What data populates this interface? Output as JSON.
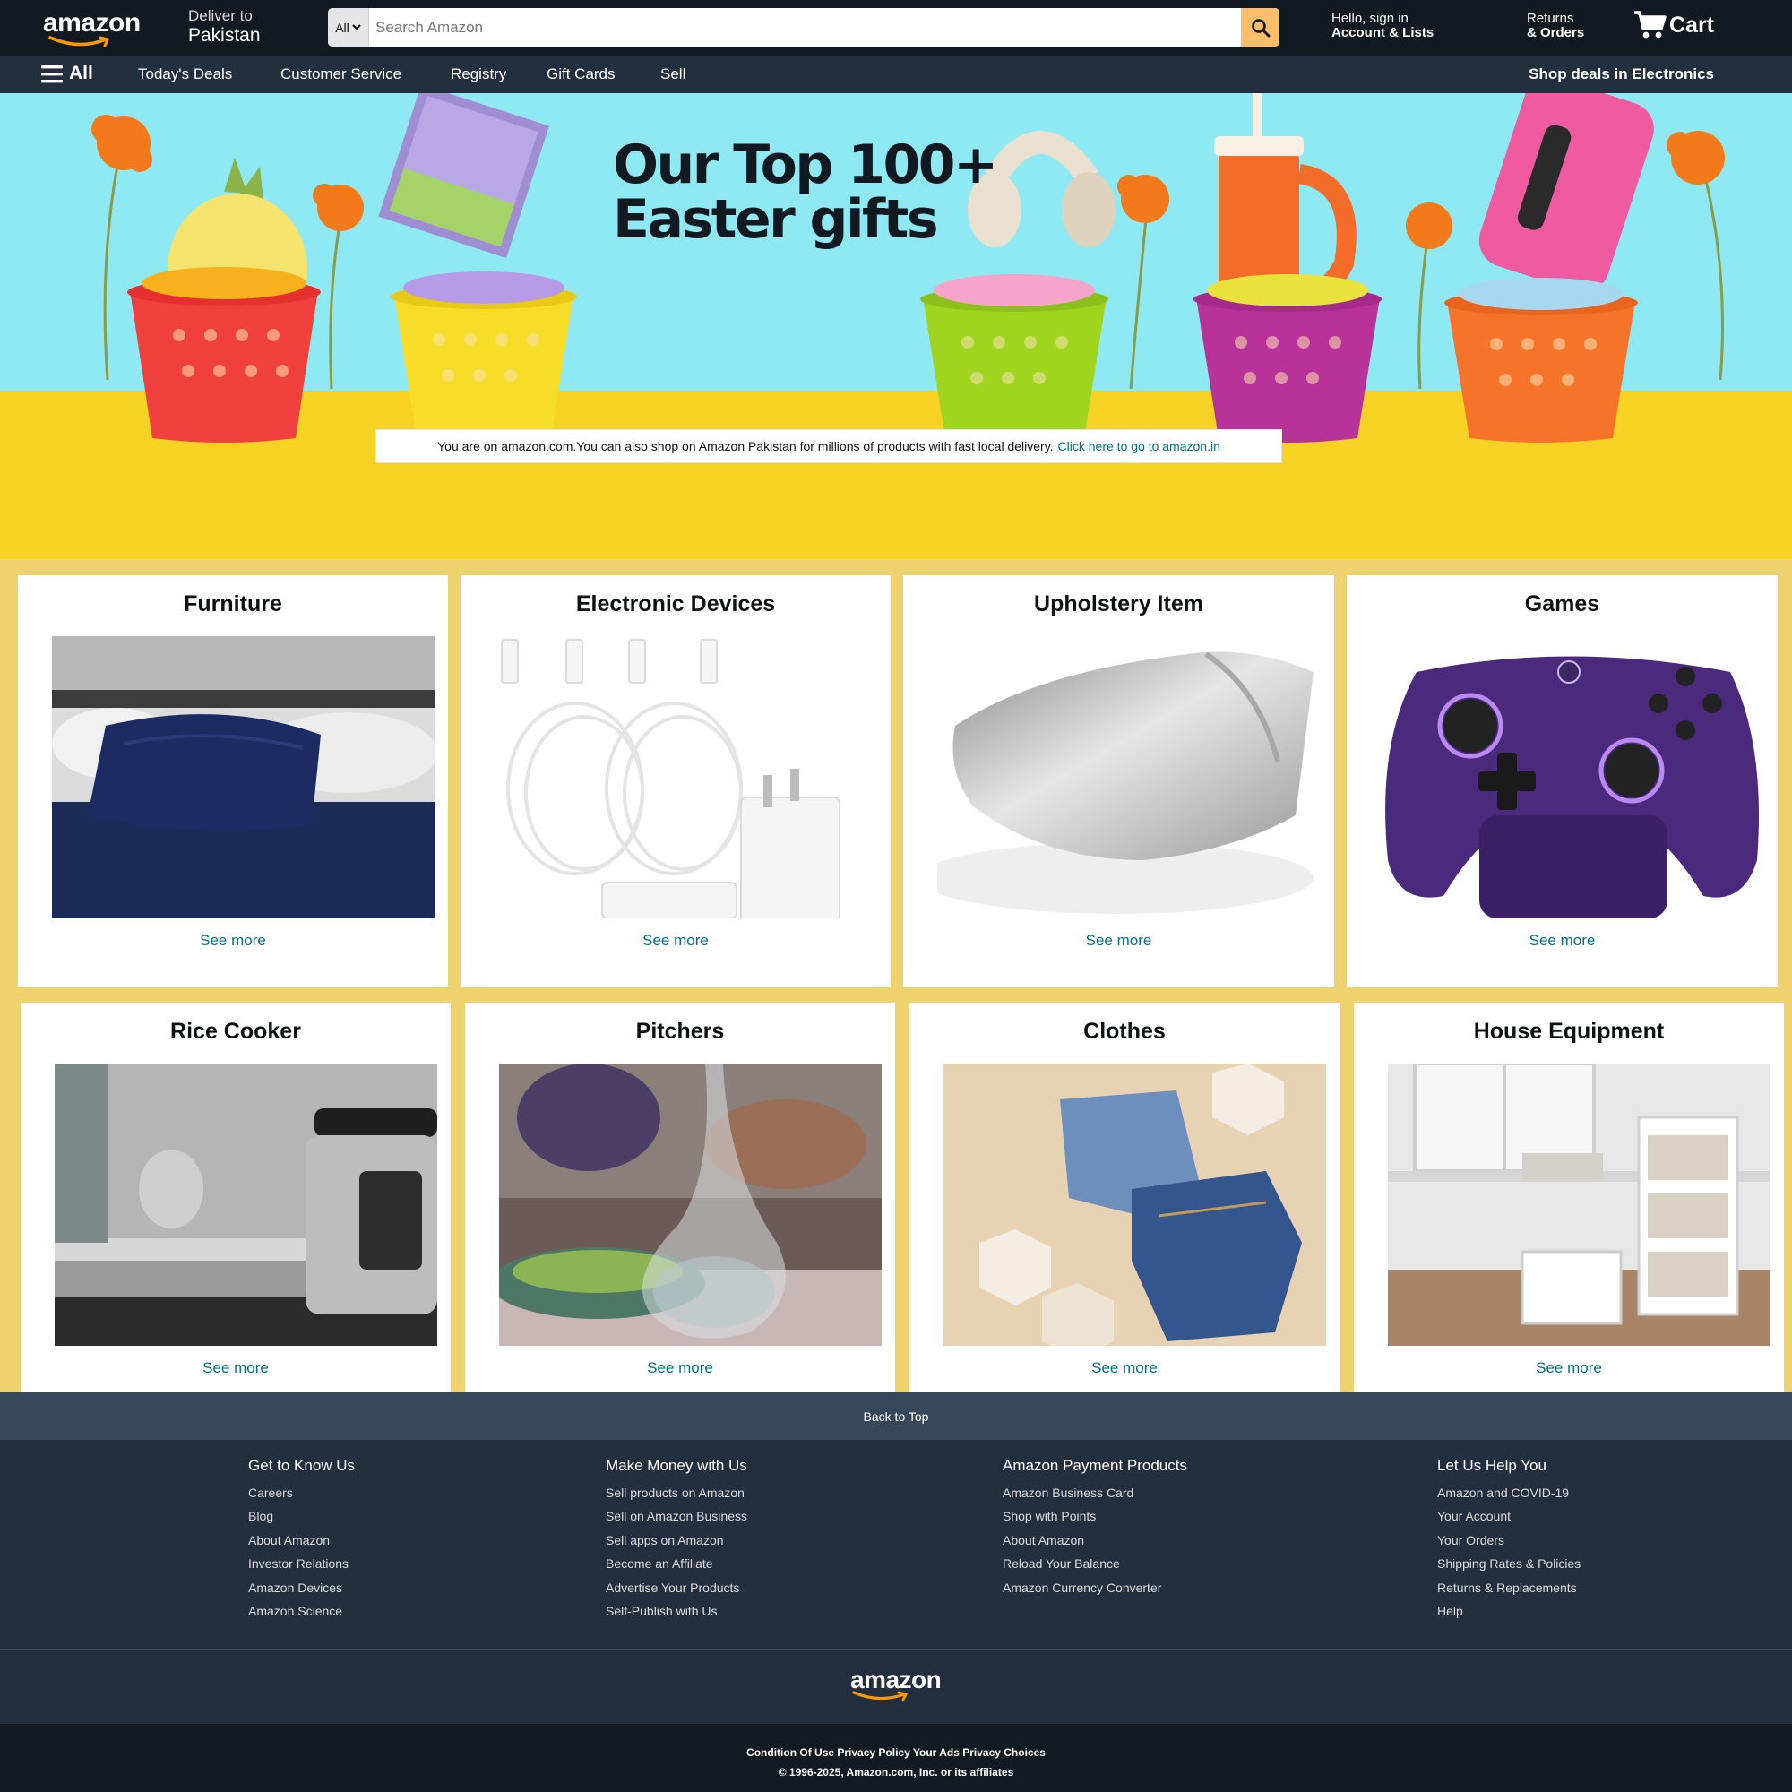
{
  "header": {
    "logo": "amazon",
    "deliver_line1": "Deliver to",
    "deliver_line2": "Pakistan",
    "search_category": "All",
    "search_placeholder": "Search Amazon",
    "account_line1": "Hello, sign in",
    "account_line2": "Account & Lists",
    "returns_line1": "Returns",
    "returns_line2": "& Orders",
    "cart_label": "Cart"
  },
  "nav": {
    "all_label": "All",
    "links": [
      "Today's Deals",
      "Customer Service",
      "Registry",
      "Gift Cards",
      "Sell"
    ],
    "promo": "Shop deals in Electronics"
  },
  "hero": {
    "headline_line1": "Our Top 100+",
    "headline_line2": "Easter gifts",
    "notice_text": "You are on amazon.com.You can also shop on Amazon Pakistan for millions of products with fast local delivery.",
    "notice_link": "Click here to go to amazon.in"
  },
  "cards": [
    {
      "title": "Furniture",
      "cta": "See more"
    },
    {
      "title": "Electronic Devices",
      "cta": "See more"
    },
    {
      "title": "Upholstery Item",
      "cta": "See more"
    },
    {
      "title": "Games",
      "cta": "See more"
    },
    {
      "title": "Rice Cooker",
      "cta": "See more"
    },
    {
      "title": "Pitchers",
      "cta": "See more"
    },
    {
      "title": "Clothes",
      "cta": "See more"
    },
    {
      "title": "House Equipment",
      "cta": "See more"
    }
  ],
  "footer": {
    "back_to_top": "Back to Top",
    "columns": [
      {
        "heading": "Get to Know Us",
        "links": [
          "Careers",
          "Blog",
          "About Amazon",
          "Investor Relations",
          "Amazon Devices",
          "Amazon Science"
        ]
      },
      {
        "heading": "Make Money with Us",
        "links": [
          "Sell products on Amazon",
          "Sell on Amazon Business",
          "Sell apps on Amazon",
          "Become an Affiliate",
          "Advertise Your Products",
          "Self-Publish with Us"
        ]
      },
      {
        "heading": "Amazon Payment Products",
        "links": [
          "Amazon Business Card",
          "Shop with Points",
          "About Amazon",
          "Reload Your Balance",
          "Amazon Currency Converter"
        ]
      },
      {
        "heading": "Let Us Help You",
        "links": [
          "Amazon and COVID-19",
          "Your Account",
          "Your Orders",
          "Shipping Rates & Policies",
          "Returns & Replacements",
          "Help"
        ]
      }
    ],
    "logo": "amazon",
    "legal": "Condition Of Use Privacy Policy Your Ads Privacy Choices",
    "copyright": "© 1996-2025, Amazon.com, Inc. or its affiliates"
  },
  "colors": {
    "header_bg": "#131921",
    "nav_bg": "#232f3e",
    "search_button": "#febd69",
    "link": "#007185",
    "page_bg": "#eed26f",
    "hero_sky": "#8fe9f2",
    "hero_floor": "#f5d224",
    "back_to_top_bg": "#37475a"
  },
  "icons": [
    "amazon-smile-icon",
    "search-icon",
    "chevron-down-icon",
    "cart-icon",
    "hamburger-menu-icon"
  ]
}
